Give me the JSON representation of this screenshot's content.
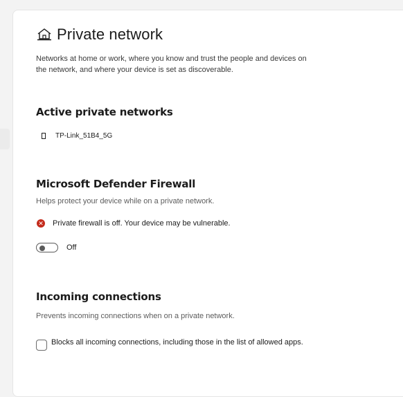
{
  "page": {
    "title": "Private network",
    "title_icon": "home-icon",
    "description": "Networks at home or work, where you know and trust the people and devices on the network, and where your device is set as discoverable."
  },
  "active_networks": {
    "heading": "Active private networks",
    "items": [
      {
        "name": "TP-Link_51B4_5G",
        "icon": "network-icon"
      }
    ]
  },
  "firewall": {
    "heading": "Microsoft Defender Firewall",
    "subtitle": "Helps protect your device while on a private network.",
    "warning": "Private firewall is off. Your device may be vulnerable.",
    "warning_icon": "error-icon",
    "warning_color": "#c42b1c",
    "toggle_label": "Off",
    "toggle_on": false
  },
  "incoming": {
    "heading": "Incoming connections",
    "subtitle": "Prevents incoming connections when on a private network.",
    "checkbox_label": "Blocks all incoming connections, including those in the list of allowed apps.",
    "checked": false
  }
}
